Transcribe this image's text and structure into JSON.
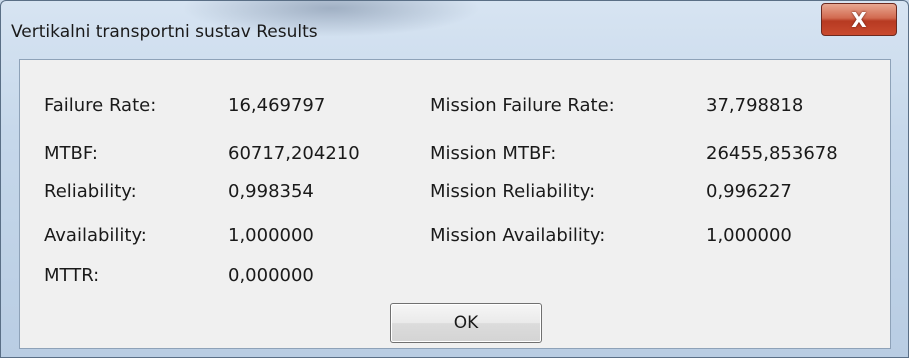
{
  "window": {
    "title": "Vertikalni transportni sustav Results",
    "close_symbol": "X"
  },
  "results": {
    "left": [
      {
        "label": "Failure Rate:",
        "value": "16,469797"
      },
      {
        "label": "MTBF:",
        "value": "60717,204210"
      },
      {
        "label": "Reliability:",
        "value": "0,998354"
      },
      {
        "label": "Availability:",
        "value": "1,000000"
      },
      {
        "label": "MTTR:",
        "value": "0,000000"
      }
    ],
    "right": [
      {
        "label": "Mission Failure Rate:",
        "value": "37,798818"
      },
      {
        "label": "Mission MTBF:",
        "value": "26455,853678"
      },
      {
        "label": "Mission Reliability:",
        "value": "0,996227"
      },
      {
        "label": "Mission Availability:",
        "value": "1,000000"
      }
    ]
  },
  "buttons": {
    "ok_label": "OK"
  },
  "colors": {
    "close_button": "#c94a2e",
    "dialog_background": "#f0f0f0",
    "frame": "#c5d7ea"
  },
  "icons": {
    "close": "close-icon"
  }
}
